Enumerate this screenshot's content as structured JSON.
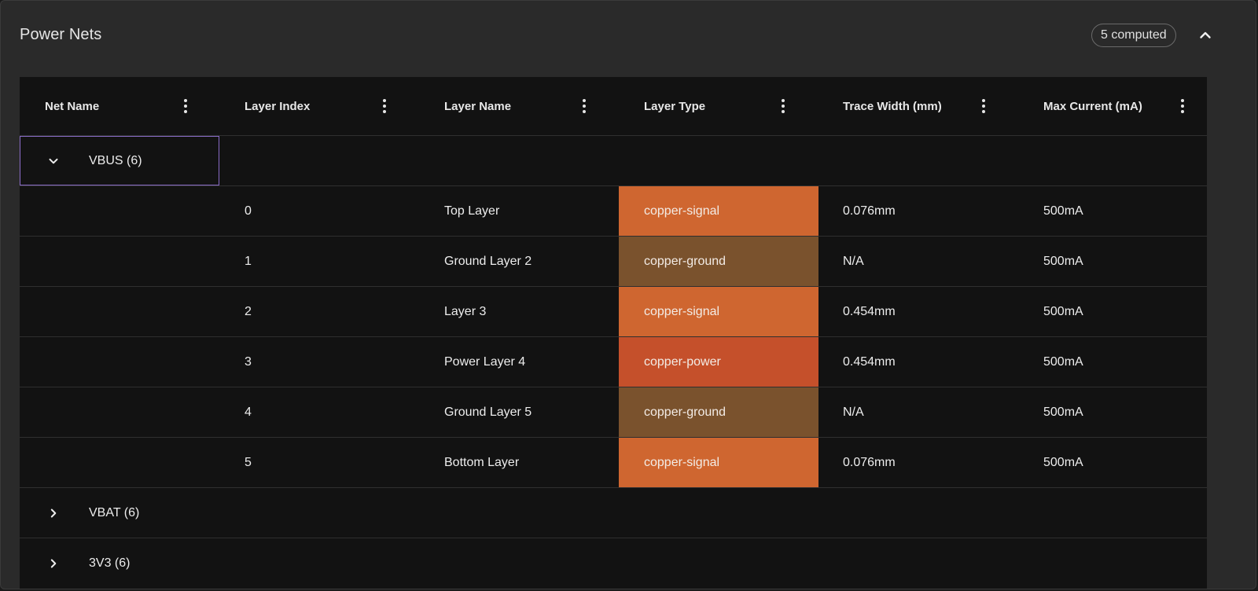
{
  "panel": {
    "title": "Power Nets",
    "computed_badge": "5 computed",
    "collapse_icon": "chevron-up-icon"
  },
  "colors": {
    "copper-signal": "#cf6630",
    "copper-ground": "#7a522d",
    "copper-power": "#c5502b",
    "focus_outline": "#8a6cc8"
  },
  "table": {
    "columns": [
      {
        "label": "Net Name"
      },
      {
        "label": "Layer Index"
      },
      {
        "label": "Layer Name"
      },
      {
        "label": "Layer Type"
      },
      {
        "label": "Trace Width (mm)"
      },
      {
        "label": "Max Current (mA)"
      }
    ],
    "groups": [
      {
        "label": "VBUS (6)",
        "expanded": true,
        "rows": [
          {
            "index": "0",
            "name": "Top Layer",
            "type": "copper-signal",
            "width": "0.076mm",
            "current": "500mA"
          },
          {
            "index": "1",
            "name": "Ground Layer 2",
            "type": "copper-ground",
            "width": "N/A",
            "current": "500mA"
          },
          {
            "index": "2",
            "name": "Layer 3",
            "type": "copper-signal",
            "width": "0.454mm",
            "current": "500mA"
          },
          {
            "index": "3",
            "name": "Power Layer 4",
            "type": "copper-power",
            "width": "0.454mm",
            "current": "500mA"
          },
          {
            "index": "4",
            "name": "Ground Layer 5",
            "type": "copper-ground",
            "width": "N/A",
            "current": "500mA"
          },
          {
            "index": "5",
            "name": "Bottom Layer",
            "type": "copper-signal",
            "width": "0.076mm",
            "current": "500mA"
          }
        ]
      },
      {
        "label": "VBAT (6)",
        "expanded": false
      },
      {
        "label": "3V3 (6)",
        "expanded": false
      }
    ]
  }
}
